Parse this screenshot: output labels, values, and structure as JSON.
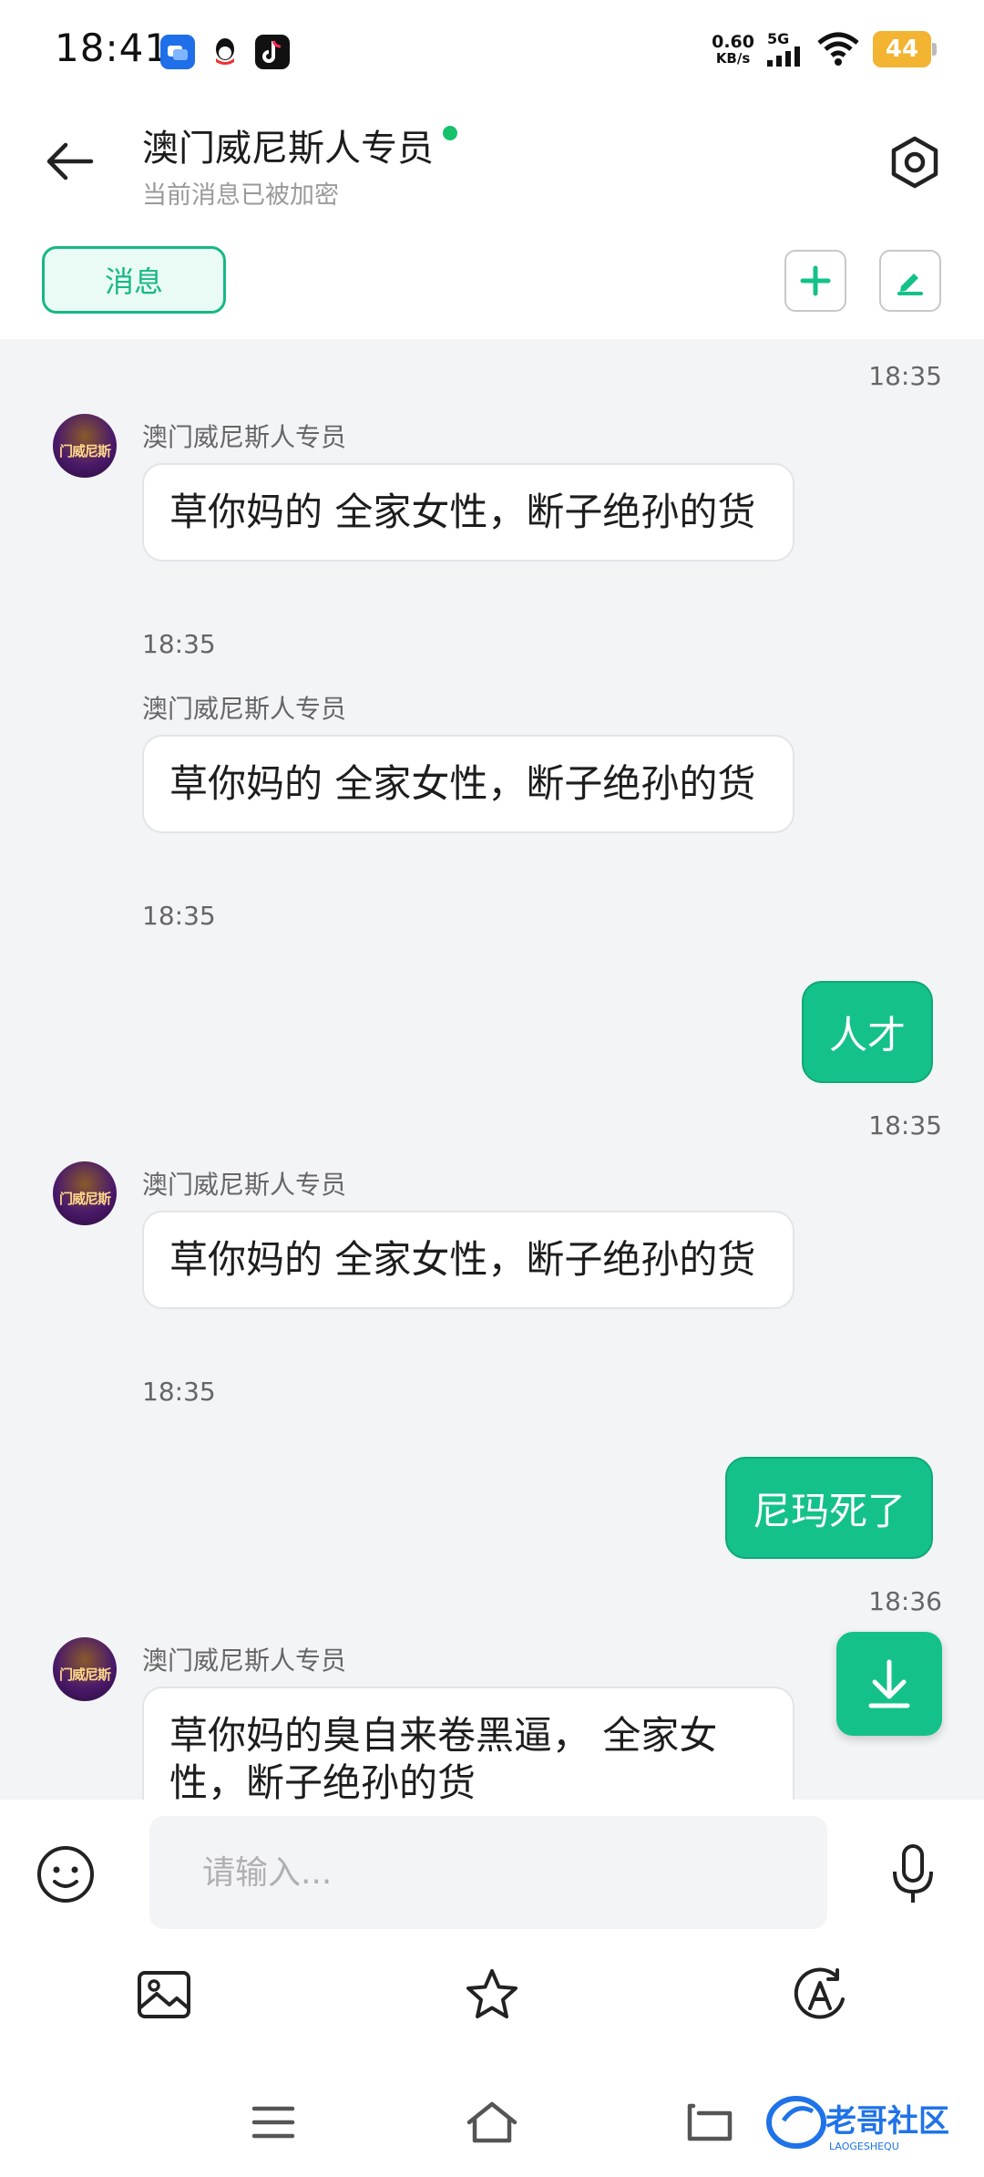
{
  "status_bar": {
    "time": "18:41",
    "net_speed_value": "0.60",
    "net_speed_unit": "KB/s",
    "network": "5G",
    "battery": "44"
  },
  "header": {
    "title": "澳门威尼斯人专员",
    "subtitle": "当前消息已被加密",
    "tab_label": "消息"
  },
  "messages": [
    {
      "type": "time",
      "text": "18:35"
    },
    {
      "type": "in",
      "sender": "澳门威尼斯人专员",
      "avatar_text": "门威尼斯",
      "text": "草你妈的 全家女性，断子绝孙的货",
      "time": "18:35"
    },
    {
      "type": "in",
      "sender": "澳门威尼斯人专员",
      "text": "草你妈的 全家女性，断子绝孙的货",
      "time": "18:35"
    },
    {
      "type": "out",
      "text": "人才",
      "time": "18:35"
    },
    {
      "type": "in",
      "sender": "澳门威尼斯人专员",
      "avatar_text": "门威尼斯",
      "text": "草你妈的 全家女性，断子绝孙的货",
      "time": "18:35"
    },
    {
      "type": "out",
      "text": "尼玛死了",
      "time": "18:36"
    },
    {
      "type": "in",
      "sender": "澳门威尼斯人专员",
      "avatar_text": "门威尼斯",
      "text": "草你妈的臭自来卷黑逼， 全家女性，断子绝孙的货"
    }
  ],
  "composer": {
    "placeholder": "请输入..."
  },
  "watermark": {
    "text": "老哥社区",
    "sub": "LAOGESHEQU"
  },
  "colors": {
    "accent": "#14c18a",
    "chat_bg": "#f3f4f6",
    "online": "#15c26b",
    "battery": "#f2b431"
  }
}
